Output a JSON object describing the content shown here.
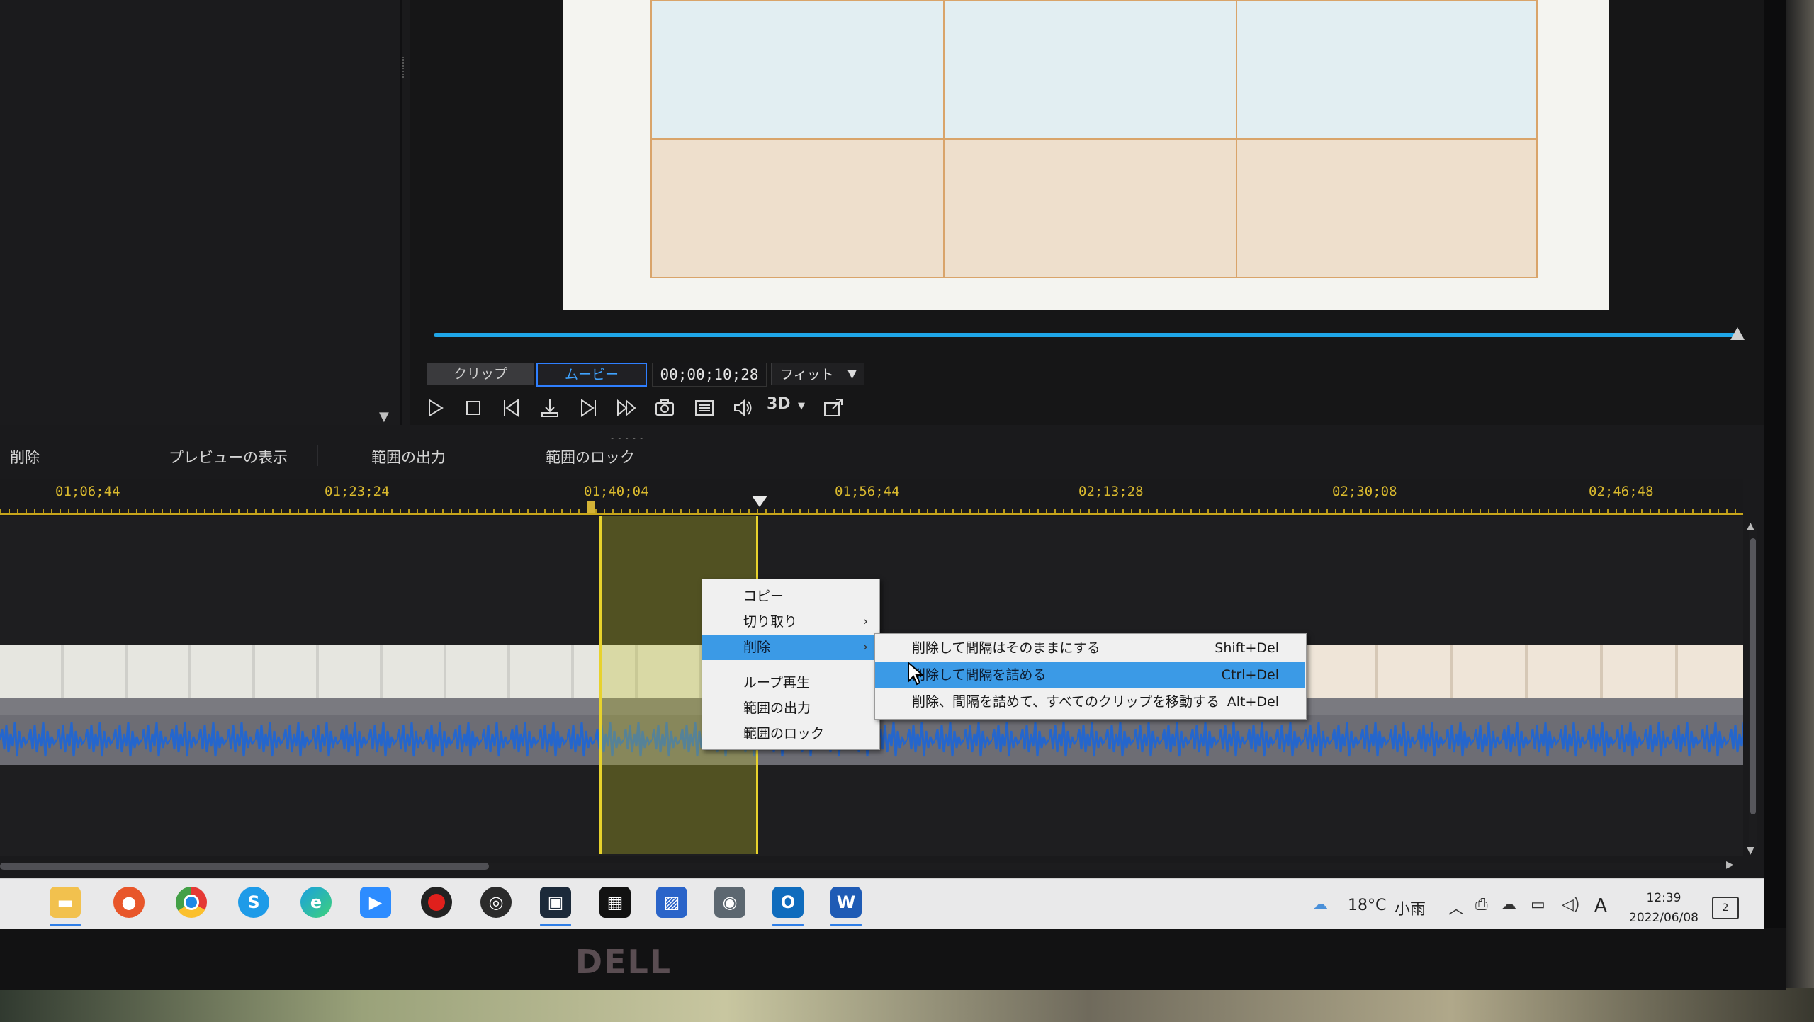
{
  "preview": {
    "mode_clip": "クリップ",
    "mode_movie": "ムービー",
    "timecode": "00;00;10;28",
    "fit": "フィット",
    "threed": "3D",
    "controls": [
      "play-icon",
      "stop-icon",
      "prev-frame-icon",
      "split-icon",
      "next-frame-icon",
      "fast-forward-icon",
      "snapshot-icon",
      "subtitle-icon",
      "volume-icon",
      "threed-icon",
      "detach-preview-icon"
    ]
  },
  "range_toolbar": {
    "items": [
      "削除",
      "プレビューの表示",
      "範囲の出力",
      "範囲のロック"
    ]
  },
  "ruler": {
    "labels": [
      "01;06;44",
      "01;23;24",
      "01;40;04",
      "01;56;44",
      "02;13;28",
      "02;30;08",
      "02;46;48"
    ]
  },
  "context_menu": {
    "items": [
      {
        "label": "コピー",
        "submenu": false
      },
      {
        "label": "切り取り",
        "submenu": true
      },
      {
        "label": "削除",
        "submenu": true,
        "selected": true
      },
      {
        "label": "ループ再生",
        "submenu": false
      },
      {
        "label": "範囲の出力",
        "submenu": false
      },
      {
        "label": "範囲のロック",
        "submenu": false
      }
    ]
  },
  "delete_submenu": {
    "items": [
      {
        "label": "削除して間隔はそのままにする",
        "shortcut": "Shift+Del"
      },
      {
        "label": "削除して間隔を詰める",
        "shortcut": "Ctrl+Del",
        "selected": true
      },
      {
        "label": "削除、間隔を詰めて、すべてのクリップを移動する",
        "shortcut": "Alt+Del"
      }
    ]
  },
  "taskbar": {
    "apps": [
      "file-explorer-icon",
      "firefox-icon",
      "chrome-icon",
      "skype-icon",
      "edge-icon",
      "zoom-icon",
      "record-icon",
      "obs-icon",
      "video-editor-icon",
      "photo-director-icon",
      "photos-icon",
      "camera-icon",
      "outlook-icon",
      "word-icon"
    ],
    "active_app": "video-editor-icon",
    "weather_temp": "18°C",
    "weather_text": "小雨",
    "ime": "A",
    "time": "12:39",
    "date": "2022/06/08",
    "notifications": "2"
  },
  "monitor_brand": "DELL",
  "colors": {
    "accent": "#1fa6e8",
    "range_highlight": "#e7d22c",
    "menu_selected": "#3b9ae6",
    "ruler_label": "#d9b92e"
  }
}
